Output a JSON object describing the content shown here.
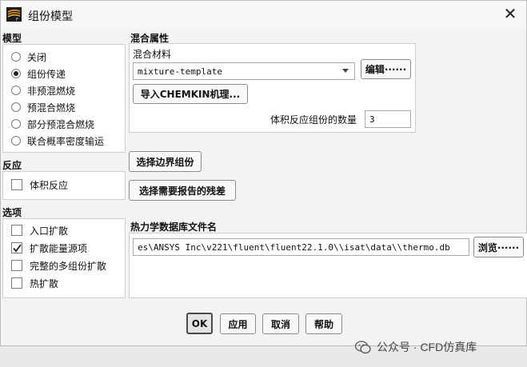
{
  "window": {
    "title": "组份模型",
    "close_symbol": "✕"
  },
  "model": {
    "title": "模型",
    "options": [
      {
        "label": "关闭",
        "selected": false
      },
      {
        "label": "组份传递",
        "selected": true
      },
      {
        "label": "非预混燃烧",
        "selected": false
      },
      {
        "label": "预混合燃烧",
        "selected": false
      },
      {
        "label": "部分预混合燃烧",
        "selected": false
      },
      {
        "label": "联合概率密度输运",
        "selected": false
      }
    ]
  },
  "reaction": {
    "title": "反应",
    "volumetric": {
      "label": "体积反应",
      "checked": false
    }
  },
  "options_section": {
    "title": "选项",
    "items": [
      {
        "label": "入口扩散",
        "checked": false
      },
      {
        "label": "扩散能量源项",
        "checked": true
      },
      {
        "label": "完整的多组份扩散",
        "checked": false
      },
      {
        "label": "热扩散",
        "checked": false
      }
    ]
  },
  "mixture_properties": {
    "title": "混合属性",
    "material_label": "混合材料",
    "material_value": "mixture-template",
    "edit_button": "编辑······",
    "import_button": "导入CHEMKIN机理...",
    "num_species_label": "体积反应组份的数量",
    "num_species_value": "3"
  },
  "buttons": {
    "boundary_species": "选择边界组份",
    "report_residuals": "选择需要报告的残差"
  },
  "thermo": {
    "title": "热力学数据库文件名",
    "path": "es\\ANSYS Inc\\v221\\fluent\\fluent22.1.0\\\\isat\\data\\\\thermo.db",
    "browse_button": "浏览······"
  },
  "footer": {
    "ok": "OK",
    "apply": "应用",
    "cancel": "取消",
    "help": "帮助"
  },
  "watermark": {
    "text": "公众号 · CFD仿真库"
  },
  "colors": {
    "check_mark": "#222222",
    "dialog_bg": "#f3f3f3"
  },
  "icons": {
    "app": "fluent-app-icon",
    "close": "close-icon",
    "dropdown": "chevron-down-icon",
    "watermark": "wechat-icon"
  }
}
